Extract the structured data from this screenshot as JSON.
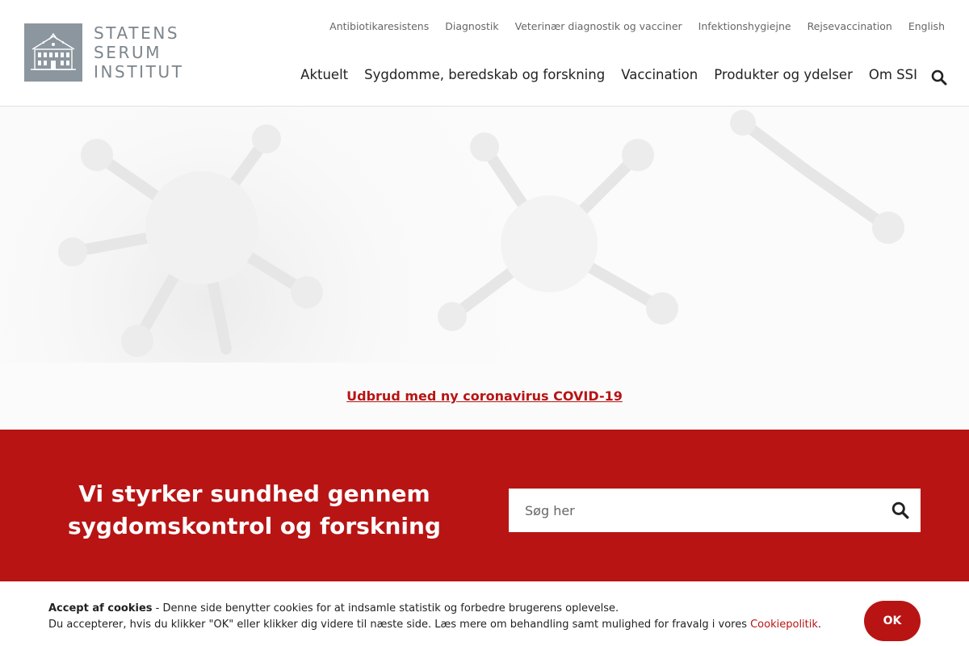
{
  "brand": {
    "logo_lines": [
      "STATENS",
      "SERUM",
      "INSTITUT"
    ],
    "logo_icon": "building-icon"
  },
  "topnav": [
    "Antibiotikaresistens",
    "Diagnostik",
    "Veterinær diagnostik og vacciner",
    "Infektionshygiejne",
    "Rejsevaccination",
    "English"
  ],
  "mainnav": [
    "Aktuelt",
    "Sygdomme, beredskab og forskning",
    "Vaccination",
    "Produkter og ydelser",
    "Om SSI"
  ],
  "alert": {
    "link": "Udbrud med ny coronavirus COVID-19"
  },
  "hero_band": {
    "mission_line1": "Vi styrker sundhed gennem",
    "mission_line2": "sygdomskontrol og forskning",
    "search_placeholder": "Søg her"
  },
  "cookie": {
    "title": "Accept af cookies",
    "line1_rest": " - Denne side benytter cookies for at indsamle statistik og forbedre brugerens oplevelse.",
    "line2": "Du accepterer, hvis du klikker \"OK\" eller klikker dig videre til næste side. Læs mere om behandling samt mulighed for fravalg i vores ",
    "policy_link": "Cookiepolitik",
    "period": ".",
    "ok_label": "OK"
  },
  "colors": {
    "accent": "#b81414",
    "logo_grey": "#8c969e"
  },
  "icons": {
    "search": "search-icon"
  }
}
